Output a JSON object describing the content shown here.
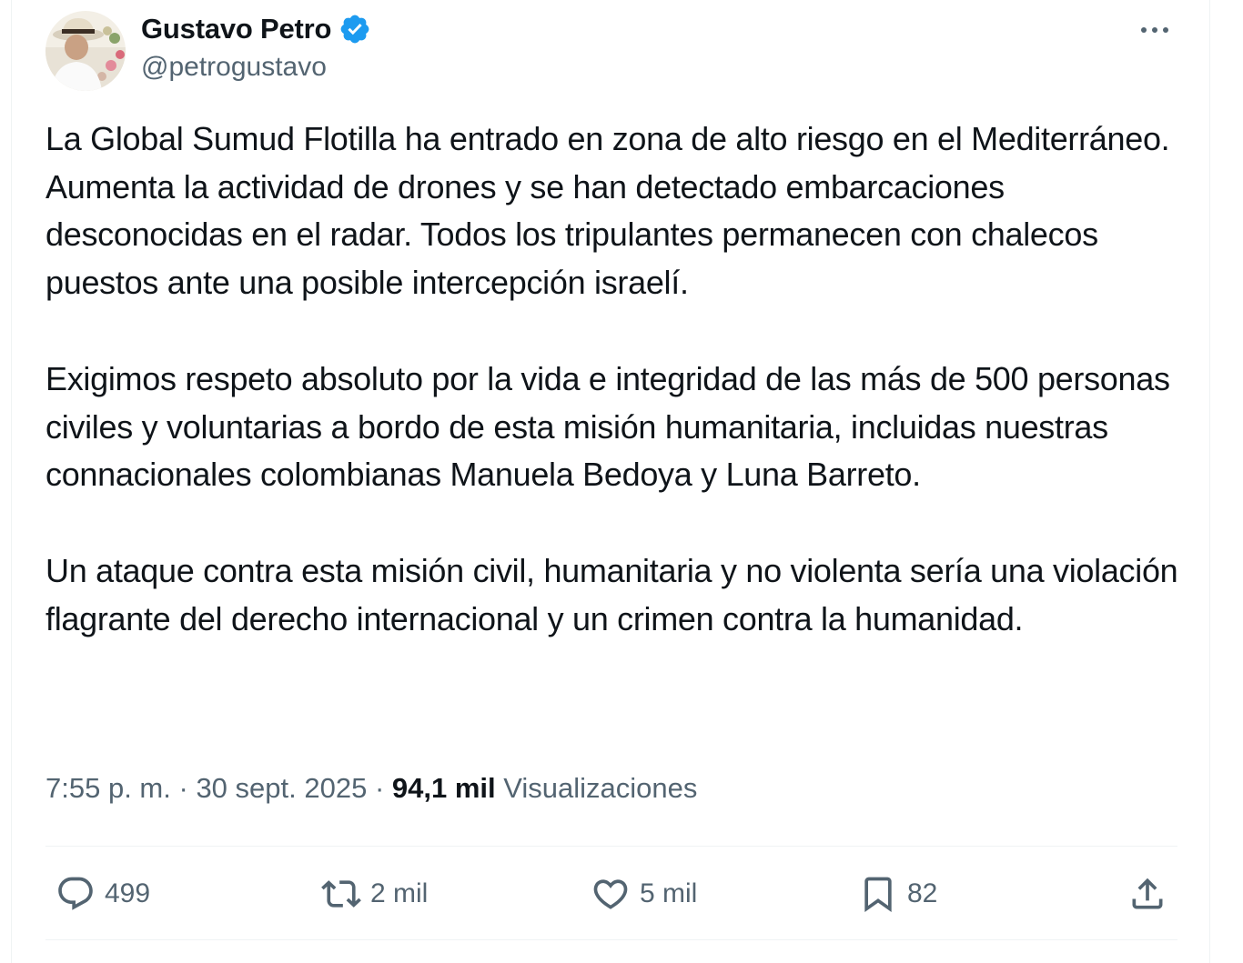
{
  "author": {
    "display_name": "Gustavo Petro",
    "handle": "@petrogustavo",
    "verified_icon": "verified-badge-icon",
    "avatar_icon": "avatar-photo"
  },
  "tweet": {
    "paragraphs": [
      "La Global Sumud Flotilla ha entrado en zona de alto riesgo en el Mediterráneo. Aumenta la actividad de drones y se han detectado embarcaciones desconocidas en el radar. Todos los tripulantes permanecen con chalecos puestos ante una posible intercepción israelí.",
      "Exigimos respeto absoluto por la vida e integridad de las más de 500 personas civiles y voluntarias a bordo de esta misión humanitaria, incluidas nuestras connacionales colombianas Manuela Bedoya y Luna Barreto.",
      "Un ataque contra esta misión civil, humanitaria y no violenta sería una violación flagrante del derecho internacional y un crimen contra la humanidad."
    ]
  },
  "meta": {
    "time": "7:55 p. m.",
    "separator": "·",
    "date": "30 sept. 2025",
    "views_count": "94,1 mil",
    "views_label": "Visualizaciones"
  },
  "actions": {
    "replies": "499",
    "reposts": "2 mil",
    "likes": "5 mil",
    "bookmarks": "82"
  },
  "colors": {
    "verified": "#1d9bf0",
    "secondary_text": "#536471",
    "primary_text": "#0f1419",
    "divider": "#eff3f4"
  }
}
